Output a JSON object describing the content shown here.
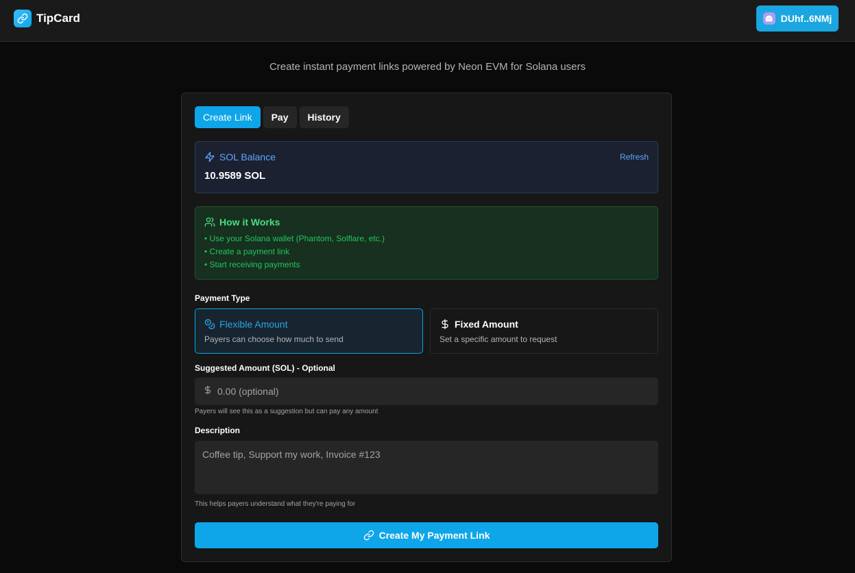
{
  "app": {
    "name": "TipCard",
    "logo_icon": "link-icon"
  },
  "wallet": {
    "label": "DUhf..6NMj",
    "avatar_icon": "phantom-ghost-icon"
  },
  "subtitle": "Create instant payment links powered by Neon EVM for Solana users",
  "tabs": [
    {
      "label": "Create Link",
      "active": true
    },
    {
      "label": "Pay",
      "active": false
    },
    {
      "label": "History",
      "active": false
    }
  ],
  "balance": {
    "title": "SOL Balance",
    "icon": "lightning-icon",
    "refresh_label": "Refresh",
    "value": "10.9589 SOL"
  },
  "how_it_works": {
    "title": "How it Works",
    "icon": "users-icon",
    "items": [
      "Use your Solana wallet (Phantom, Solflare, etc.)",
      "Create a payment link",
      "Start receiving payments"
    ]
  },
  "payment_type": {
    "label": "Payment Type",
    "options": [
      {
        "title": "Flexible Amount",
        "description": "Payers can choose how much to send",
        "icon": "coins-icon",
        "selected": true
      },
      {
        "title": "Fixed Amount",
        "description": "Set a specific amount to request",
        "icon": "dollar-icon",
        "selected": false
      }
    ]
  },
  "suggested_amount": {
    "label": "Suggested Amount (SOL) - Optional",
    "value": "",
    "placeholder": "0.00 (optional)",
    "help": "Payers will see this as a suggestion but can pay any amount"
  },
  "description": {
    "label": "Description",
    "value": "",
    "placeholder": "Coffee tip, Support my work, Invoice #123",
    "help": "This helps payers understand what they're paying for"
  },
  "submit": {
    "label": "Create My Payment Link",
    "icon": "link-icon"
  },
  "colors": {
    "accent": "#0ea5e9",
    "info": "#60a5fa",
    "success": "#22c55e",
    "background": "#0a0a0a",
    "surface": "#171717"
  }
}
